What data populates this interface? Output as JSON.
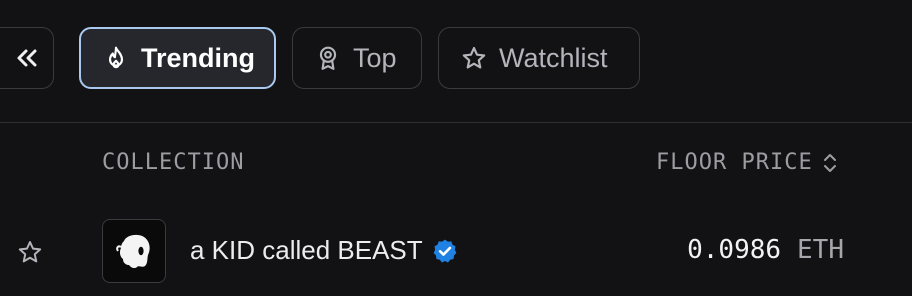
{
  "toolbar": {
    "collapse_icon": "double-chevron-left-icon",
    "tabs": [
      {
        "label": "Trending",
        "icon": "flame-icon",
        "active": true
      },
      {
        "label": "Top",
        "icon": "award-icon",
        "active": false
      },
      {
        "label": "Watchlist",
        "icon": "star-icon",
        "active": false
      }
    ]
  },
  "table": {
    "headers": {
      "collection": "COLLECTION",
      "floor_price": "FLOOR PRICE",
      "sort_icon": "sort-updown-icon"
    },
    "rows": [
      {
        "favorite_icon": "star-outline-icon",
        "avatar_icon": "beast-avatar-icon",
        "name": "a KID called BEAST",
        "verified_icon": "verified-badge-icon",
        "floor_price": "0.0986",
        "currency": "ETH"
      }
    ]
  },
  "colors": {
    "background": "#121214",
    "active_tab_border": "#a9c9ef",
    "active_tab_bg": "#26272d",
    "verified_blue": "#2081e2",
    "muted_text": "#9c9ca3"
  }
}
